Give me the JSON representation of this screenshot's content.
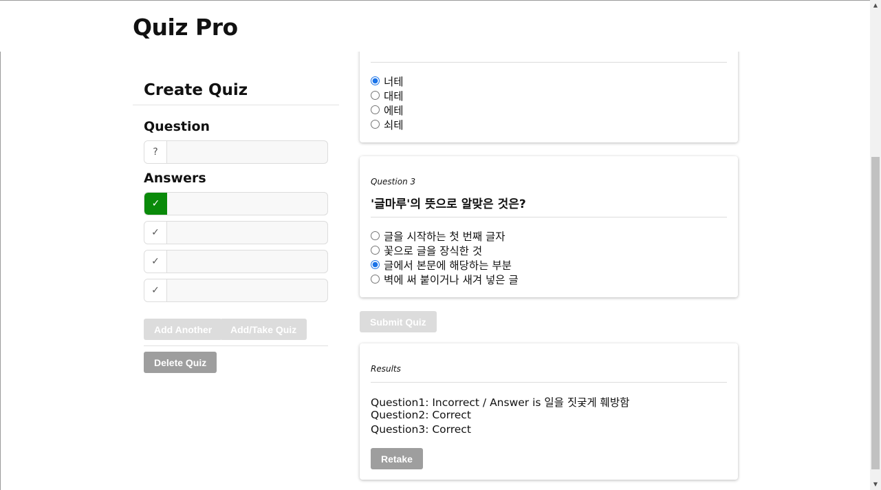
{
  "app": {
    "title": "Quiz Pro"
  },
  "create": {
    "title": "Create Quiz",
    "question_label": "Question",
    "question_addon": "?",
    "question_value": "",
    "answers_label": "Answers",
    "answers": [
      {
        "mark": "✓",
        "value": "",
        "correct": true
      },
      {
        "mark": "✓",
        "value": "",
        "correct": false
      },
      {
        "mark": "✓",
        "value": "",
        "correct": false
      },
      {
        "mark": "✓",
        "value": "",
        "correct": false
      }
    ],
    "add_another": "Add Another",
    "add_take": "Add/Take Quiz",
    "delete": "Delete Quiz"
  },
  "quiz": {
    "q2": {
      "options": [
        "너테",
        "대테",
        "에테",
        "쇠테"
      ],
      "selected_index": 0
    },
    "q3": {
      "number": "Question 3",
      "text": "'글마루'의 뜻으로 알맞은 것은?",
      "options": [
        "글을 시작하는 첫 번째 글자",
        "꽃으로 글을 장식한 것",
        "글에서 본문에 해당하는 부분",
        "벽에 써 붙이거나 새겨 넣은 글"
      ],
      "selected_index": 2
    },
    "submit": "Submit Quiz"
  },
  "results": {
    "title": "Results",
    "lines": [
      "Question1: Incorrect / Answer is 일을 짓궂게 훼방함",
      "Question2: Correct",
      "Question3: Correct"
    ],
    "retake": "Retake"
  },
  "colors": {
    "correct": "#0a8a0a",
    "disabled_button": "#dcdcdc",
    "grey_button": "#9e9e9e"
  }
}
